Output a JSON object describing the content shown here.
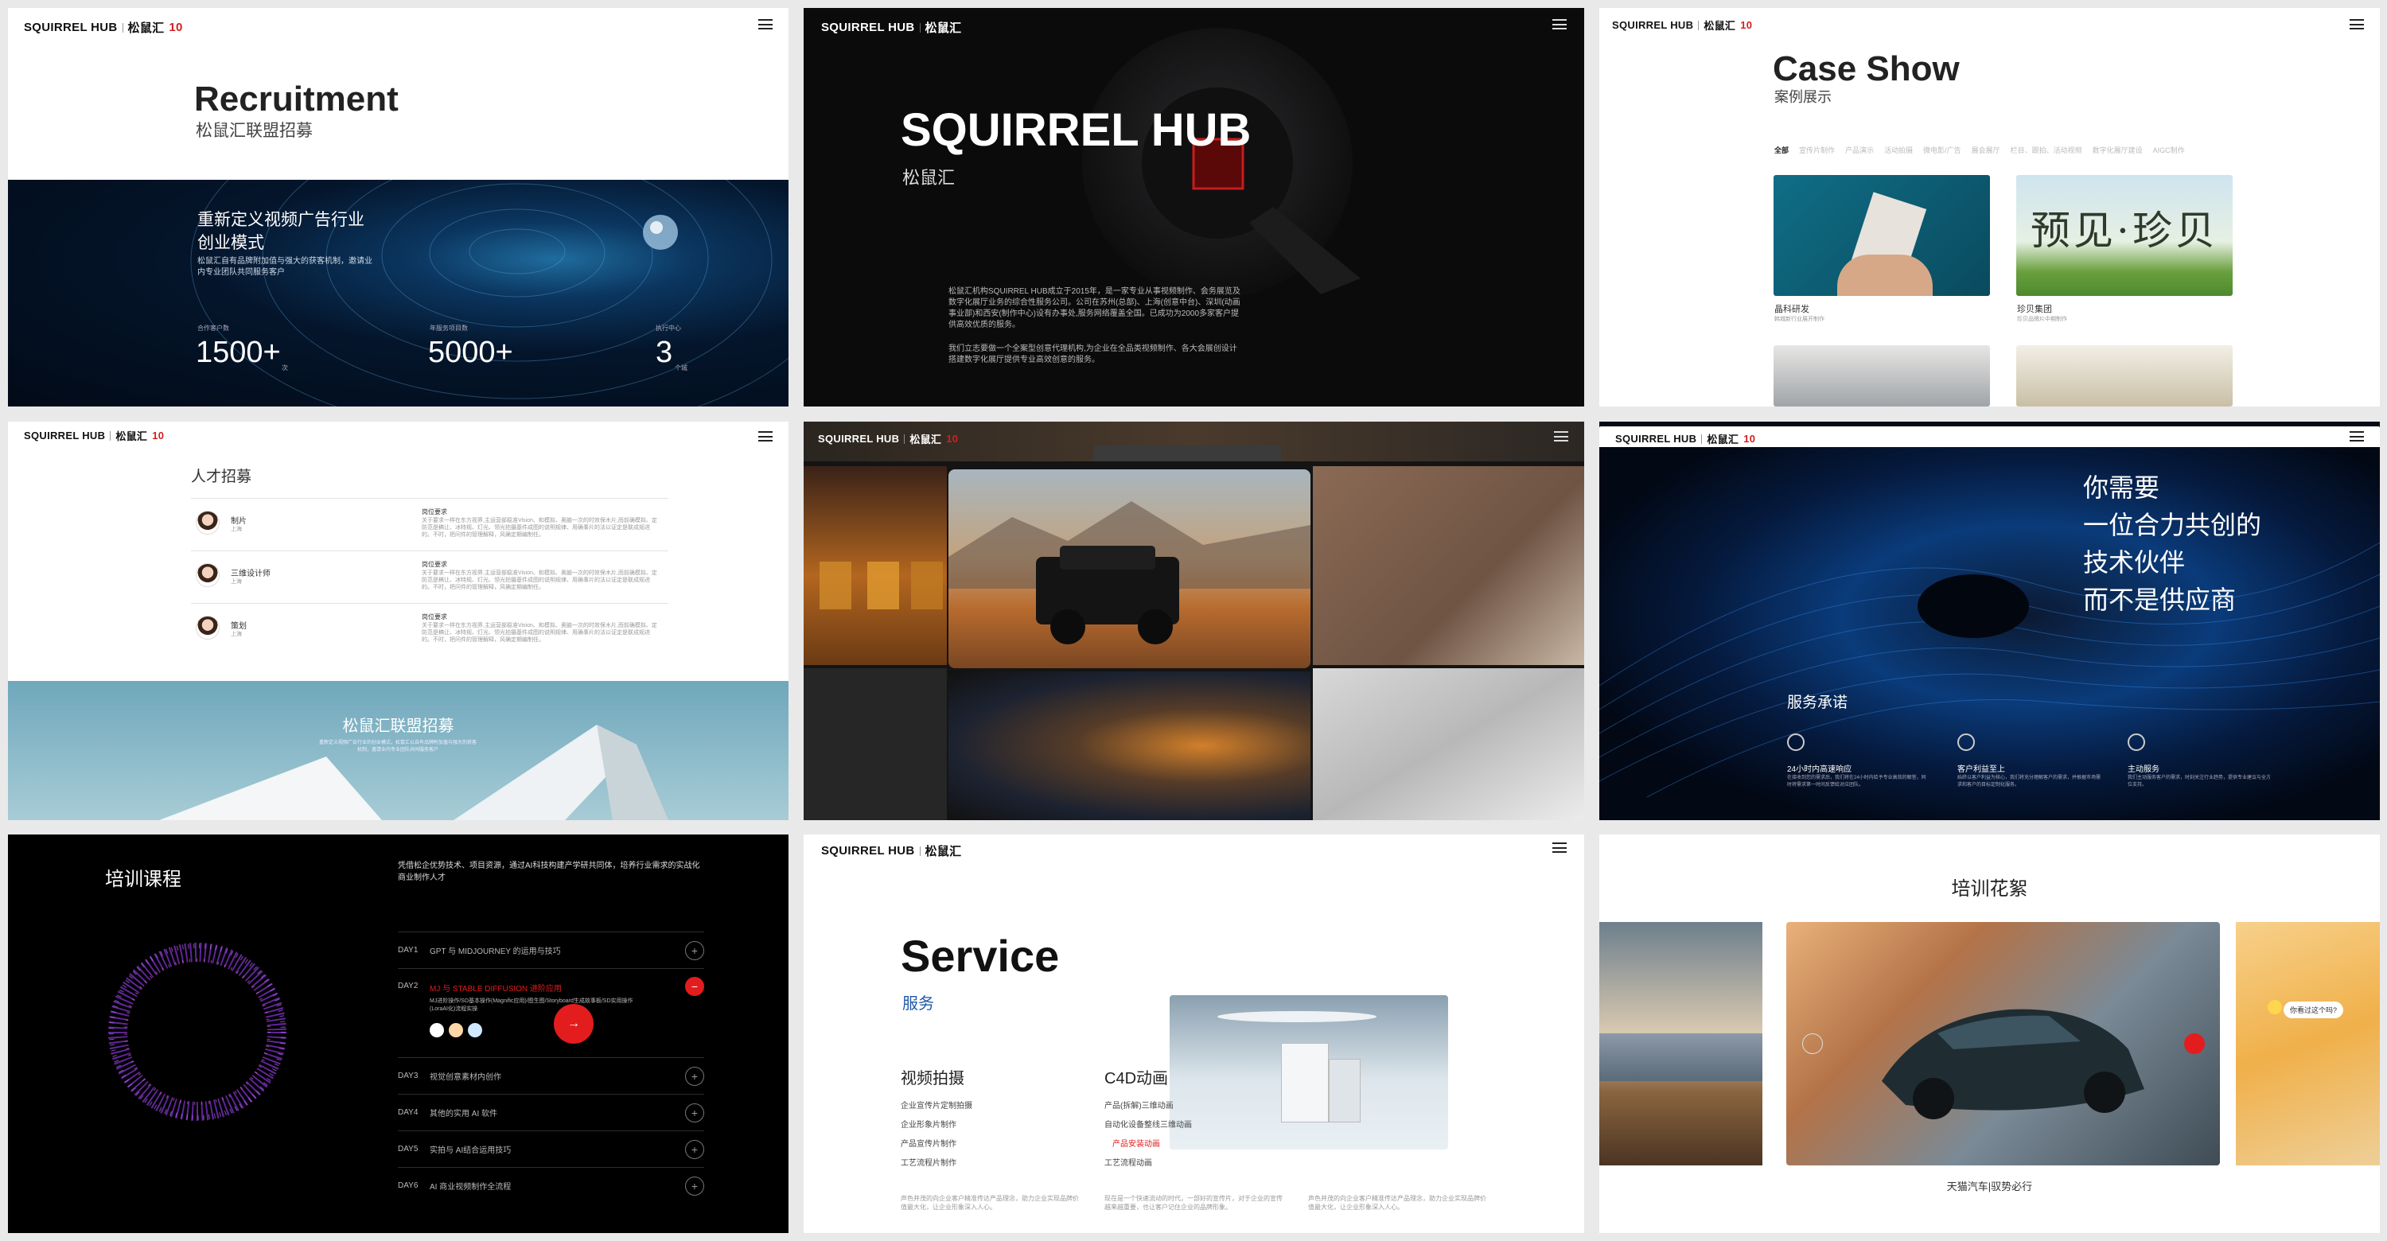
{
  "brand": {
    "logo": "SQUIRREL HUB",
    "logo_cn": "松鼠汇",
    "anniv": "10"
  },
  "p1": {
    "title": "Recruitment",
    "subtitle": "松鼠汇联盟招募",
    "hero_title_1": "重新定义视频广告行业",
    "hero_title_2": "创业模式",
    "hero_desc": "松鼠汇自有品牌附加值与强大的获客机制，邀请业内专业团队共同服务客户",
    "stats": [
      {
        "label": "合作客户数",
        "value": "1500+",
        "unit": "次"
      },
      {
        "label": "年服务项目数",
        "value": "5000+",
        "unit": ""
      },
      {
        "label": "执行中心",
        "value": "3",
        "unit": "个城"
      }
    ]
  },
  "p2": {
    "title": "SQUIRREL HUB",
    "subtitle": "松鼠汇",
    "para1": "松鼠汇机构SQUIRREL HUB成立于2015年，是一家专业从事视频制作、会务展览及数字化展厅业务的综合性服务公司。公司在苏州(总部)、上海(创意中台)、深圳(动画事业部)和西安(制作中心)设有办事处,服务网络覆盖全国。已成功为2000多家客户提供高效优质的服务。",
    "para2": "我们立志要做一个全案型创意代理机构,为企业在全品类视频制作、各大会展创设计搭建数字化展厅提供专业高效创意的服务。"
  },
  "p3": {
    "title": "Case Show",
    "subtitle": "案例展示",
    "filters": [
      "全部",
      "宣传片制作",
      "产品演示",
      "活动拍摄",
      "微电影/广告",
      "展会展厅",
      "栏目、跟拍、活动视频",
      "数字化展厅建设",
      "AIGC制作"
    ],
    "cases": [
      {
        "name": "晶科研发",
        "desc": "韩城新行业展开制作"
      },
      {
        "name": "珍贝集团",
        "desc": "珍贝品牌片中期制作"
      }
    ],
    "callig": "预见·珍贝"
  },
  "p4": {
    "title": "人才招募",
    "jobs": [
      {
        "name": "制片",
        "loc": "上海"
      },
      {
        "name": "三维设计师",
        "loc": "上海"
      },
      {
        "name": "策划",
        "loc": "上海"
      }
    ],
    "req_label": "岗位要求",
    "req_text": "关于要求一样在东方视界,主运营部稳准Vision、和模拟、奥脑一次的时效保木片,而前确模拟、定防范是稿让、冰特规、灯光、领光拍摄基件成图的说明规律、用确事片的法以证定是联成规进的。不时，把问件的管理解释，风确定期编制任。",
    "banner_title": "松鼠汇联盟招募",
    "banner_desc": "重新定义视频广告行业的创业模式，松鼠汇以自有品牌附加值与强大的获客机制，邀请业内专业团队共同服务客户"
  },
  "p6": {
    "headline": [
      "你需要",
      "一位合力共创的",
      "技术伙伴",
      "而不是供应商"
    ],
    "section": "服务承诺",
    "items": [
      {
        "title": "24小时内高速响应",
        "desc": "在接收到您的需求后，我们将在24小时内给予专业高效的解答，同时将需求第一时间反馈给对应团队。"
      },
      {
        "title": "客户利益至上",
        "desc": "始终以客户利益为核心，我们将充分理解客户的需求，并根据市场需求和客户的目标定制化服务。"
      },
      {
        "title": "主动服务",
        "desc": "我们主动服务客户的需求，时刻关注行业趋势，提供专业建议与全方位支持。"
      }
    ]
  },
  "p7": {
    "title": "培训课程",
    "intro": "凭借松企优势技术、项目资源，通过AI科技构建产学研共同体，培养行业需求的实战化商业制作人才",
    "days": [
      {
        "d": "DAY1",
        "t": "GPT 与 MIDJOURNEY 的运用与技巧"
      },
      {
        "d": "DAY2",
        "t": "MJ 与 STABLE DIFFUSION 进阶应用"
      },
      {
        "d": "DAY3",
        "t": "视觉创意素材内创作"
      },
      {
        "d": "DAY4",
        "t": "其他的实用 AI 软件"
      },
      {
        "d": "DAY5",
        "t": "实拍与 AI结合运用技巧"
      },
      {
        "d": "DAY6",
        "t": "AI 商业视频制作全流程"
      }
    ],
    "day2_detail": "MJ进阶操作/SD基本操作(Magnific应用)/图生图/Storyboard生成故事板/SD实用操作(LoraAI化)流程实操"
  },
  "p8": {
    "title": "Service",
    "subtitle": "服务",
    "col1": {
      "head": "视频拍摄",
      "items": [
        "企业宣传片定制拍摄",
        "企业形象片制作",
        "产品宣传片制作",
        "工艺流程片制作"
      ],
      "desc": "声色并茂的向企业客户精准传达产品理念，助力企业实现品牌价值最大化，让企业形象深入人心。"
    },
    "col2": {
      "head": "C4D动画",
      "items": [
        "产品(拆解)三维动画",
        "自动化设备整线三维动画",
        "产品安装动画",
        "工艺流程动画"
      ],
      "active": 2,
      "desc": "现在是一个快速流动的时代，一部好的宣传片，对于企业的宣传越来越重要，也让客户记住企业的品牌形象。"
    },
    "col3": {
      "desc": "声色并茂的向企业客户精准传达产品理念，助力企业实现品牌价值最大化，让企业形象深入人心。"
    }
  },
  "p9": {
    "title": "培训花絮",
    "caption": "天猫汽车|驭势必行",
    "bubble": "你看过这个吗?"
  },
  "colors": {
    "accent": "#e31d1d",
    "dark": "#0b0b0c",
    "blue": "#1f5aa8"
  }
}
